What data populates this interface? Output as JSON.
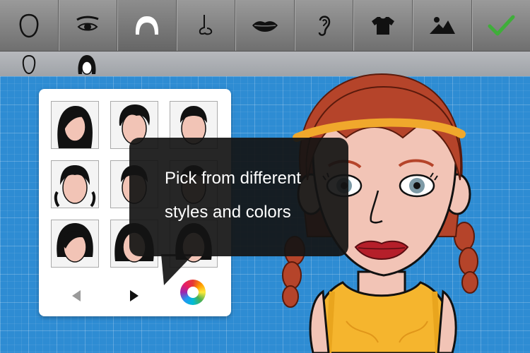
{
  "toolbar": {
    "tools": [
      {
        "name": "head-shape-icon",
        "active": false
      },
      {
        "name": "eyes-icon",
        "active": false
      },
      {
        "name": "hair-icon",
        "active": true
      },
      {
        "name": "nose-icon",
        "active": false
      },
      {
        "name": "lips-icon",
        "active": false
      },
      {
        "name": "ear-icon",
        "active": false
      },
      {
        "name": "shirt-icon",
        "active": false
      },
      {
        "name": "background-icon",
        "active": false
      },
      {
        "name": "checkmark-icon",
        "active": false
      }
    ]
  },
  "subbar": {
    "tabs": [
      "head-outline-icon",
      "hair-silhouette-icon"
    ]
  },
  "picker": {
    "prev_icon": "triangle-left-icon",
    "next_icon": "triangle-right-icon",
    "color_icon": "color-wheel-icon"
  },
  "tooltip": {
    "line1": "Pick from different",
    "line2": "styles and colors"
  },
  "colors": {
    "accent_check": "#3fae3a",
    "background": "#2e8cd3",
    "hair": "#b5442a",
    "headband": "#f0a82c",
    "shirt": "#f5b52e"
  }
}
